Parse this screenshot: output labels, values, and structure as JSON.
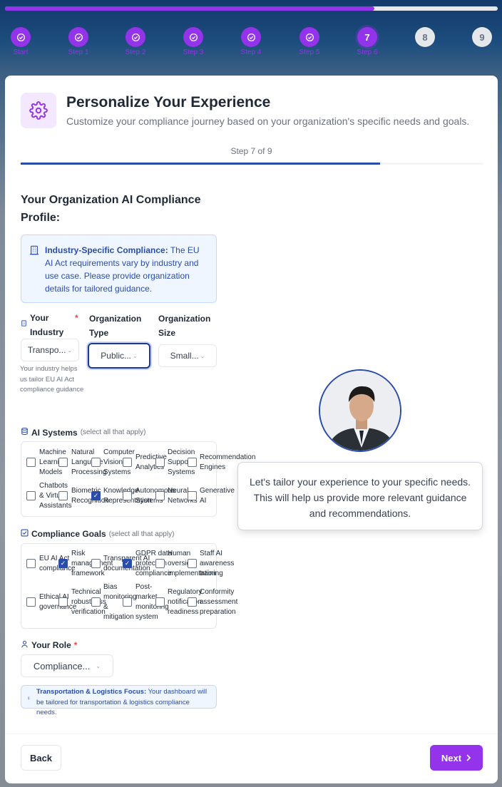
{
  "progress": {
    "fraction": 0.75
  },
  "steps": [
    {
      "label": "Start",
      "state": "done"
    },
    {
      "label": "Step 1",
      "state": "done"
    },
    {
      "label": "Step 2",
      "state": "done"
    },
    {
      "label": "Step 3",
      "state": "done"
    },
    {
      "label": "Step 4",
      "state": "done"
    },
    {
      "label": "Step 5",
      "state": "done"
    },
    {
      "label": "Step 6",
      "number": "7",
      "state": "current"
    },
    {
      "label": "",
      "number": "8",
      "state": "future"
    },
    {
      "label": "",
      "number": "9",
      "state": "future"
    }
  ],
  "header": {
    "icon": "gear-icon",
    "title": "Personalize Your Experience",
    "subtitle": "Customize your compliance journey based on your organization's specific needs and goals."
  },
  "step_indicator": {
    "text": "Step 7 of 9",
    "fraction": 0.778
  },
  "section_title": "Your Organization AI Compliance Profile:",
  "info": {
    "bold": "Industry-Specific Compliance:",
    "text": " The EU AI Act requirements vary by industry and use case. Please provide organization details for tailored guidance."
  },
  "fields": {
    "industry": {
      "label": "Your Industry",
      "value": "Transpo...",
      "helper": "Your industry helps us tailor EU AI Act compliance guidance"
    },
    "org_type": {
      "label": "Organization Type",
      "value": "Public..."
    },
    "org_size": {
      "label": "Organization Size",
      "value": "Small..."
    }
  },
  "ai_systems": {
    "title": "AI Systems",
    "note": "(select all that apply)",
    "options": [
      {
        "label": "Machine\nLearning\nModels",
        "checked": false
      },
      {
        "label": "Natural\nLanguage\nProcessing",
        "checked": false
      },
      {
        "label": "Computer\nVision\nSystems",
        "checked": false
      },
      {
        "label": "Predictive\nAnalytics",
        "checked": false
      },
      {
        "label": "Decision\nSupport\nSystems",
        "checked": false
      },
      {
        "label": "Recommendation\nEngines",
        "checked": false
      },
      {
        "label": "Chatbots\n& Virtual\nAssistants",
        "checked": false
      },
      {
        "label": "Biometric\nRecognition",
        "checked": false
      },
      {
        "label": "Knowledge\nRepresentation",
        "checked": true
      },
      {
        "label": "Autonomous\nSystems",
        "checked": false
      },
      {
        "label": "Neural\nNetworks",
        "checked": false
      },
      {
        "label": "Generative\nAI",
        "checked": false
      }
    ]
  },
  "compliance_goals": {
    "title": "Compliance Goals",
    "note": "(select all that apply)",
    "options": [
      {
        "label": "EU AI Act\ncompliance",
        "checked": false
      },
      {
        "label": "Risk\nmanagement\nframework",
        "checked": true
      },
      {
        "label": "Transparent AI\ndocumentation",
        "checked": false
      },
      {
        "label": "GDPR data\nprotection\ncompliance",
        "checked": true
      },
      {
        "label": "Human\noversight\nimplementation",
        "checked": false
      },
      {
        "label": "Staff AI\nawareness\ntraining",
        "checked": false
      },
      {
        "label": "Ethical AI\ngovernance",
        "checked": false
      },
      {
        "label": "Technical\nrobustness\nverification",
        "checked": false
      },
      {
        "label": "Bias\nmonitoring\n&\nmitigation",
        "checked": false
      },
      {
        "label": "Post-\nmarket\nmonitoring\nsystem",
        "checked": false
      },
      {
        "label": "Regulatory\nnotification\nreadiness",
        "checked": false
      },
      {
        "label": "Conformity\nassessment\npreparation",
        "checked": false
      }
    ]
  },
  "role": {
    "label": "Your Role",
    "value": "Compliance..."
  },
  "focus": {
    "bold": "Transportation & Logistics Focus:",
    "text": " Your dashboard will be tailored for transportation & logistics compliance needs."
  },
  "footer": {
    "back": "Back",
    "next": "Next"
  },
  "assistant": {
    "message": "Let's tailor your experience to your specific needs. This will help us provide more relevant guidance and recommendations."
  },
  "colors": {
    "accent": "#9333ea",
    "primary": "#2a4dab",
    "info_bg": "#eff6ff"
  }
}
